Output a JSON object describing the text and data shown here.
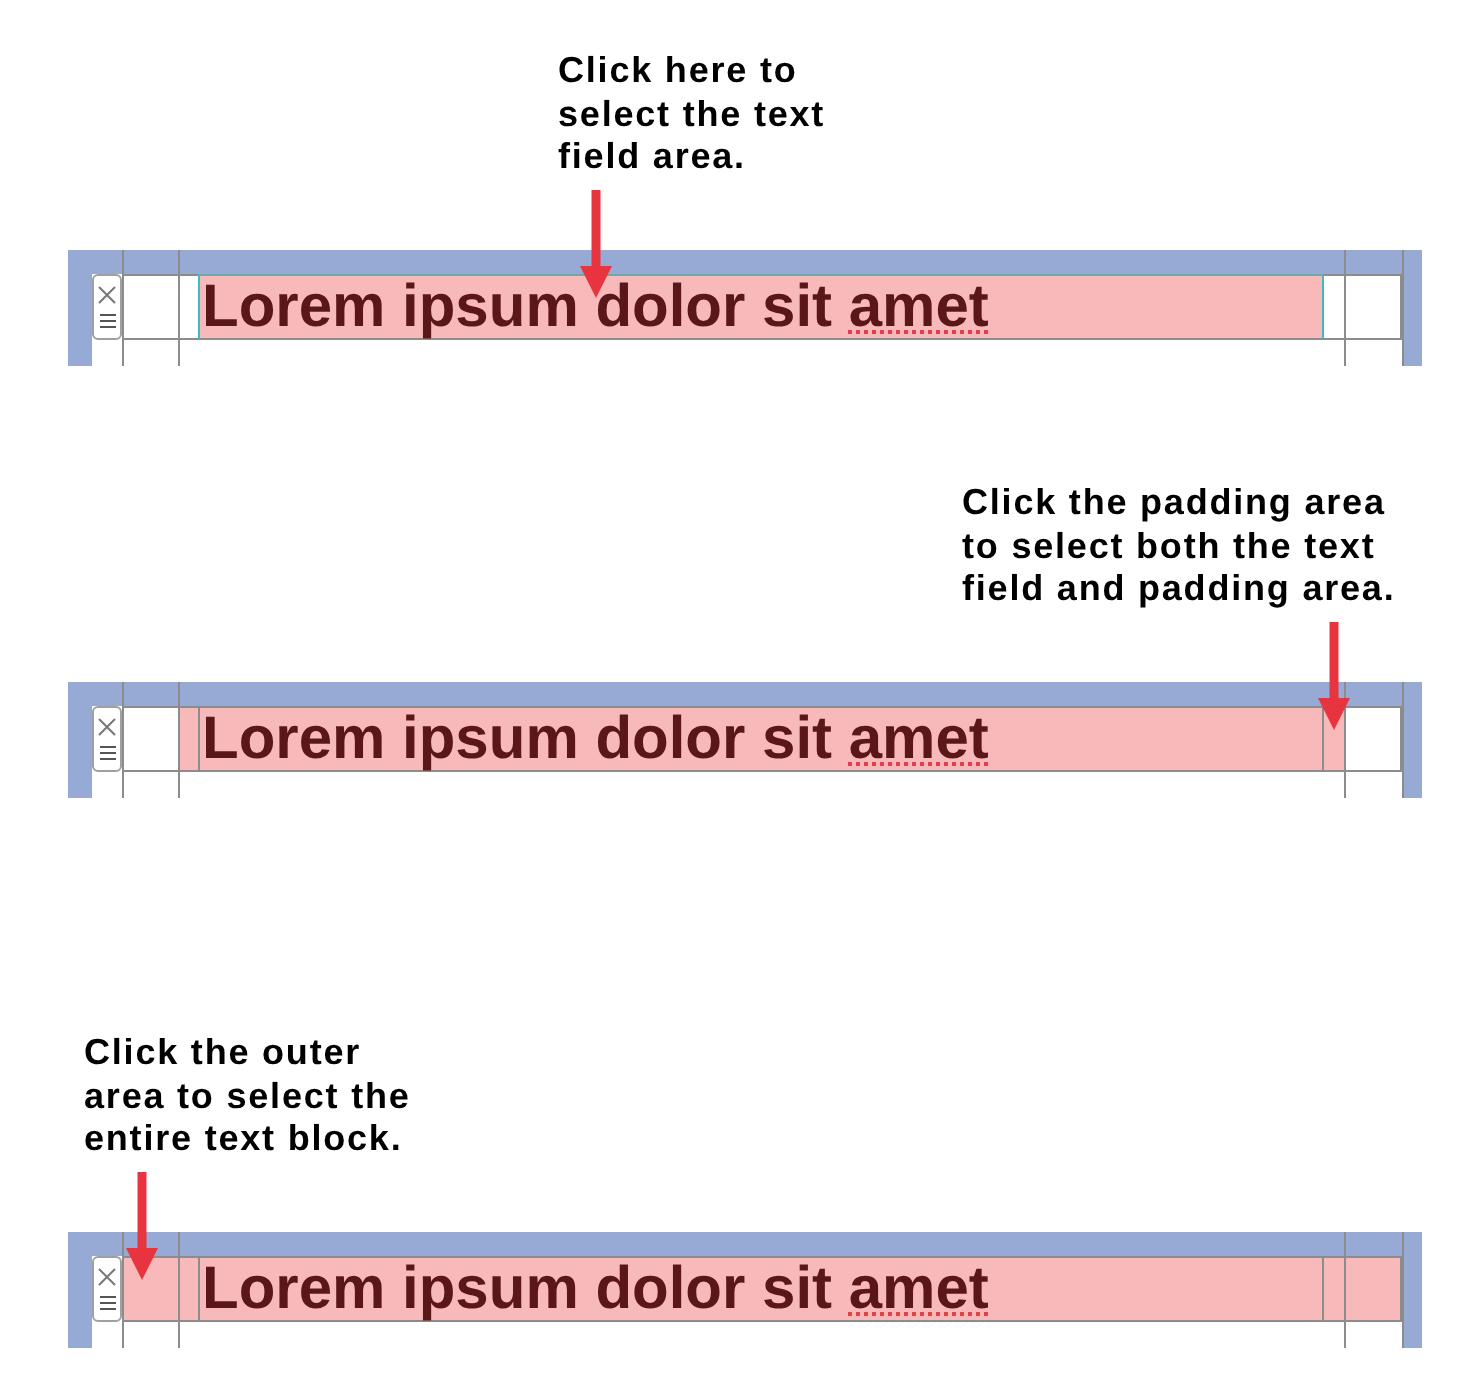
{
  "panels": [
    {
      "callout": "Click here to\nselect the text\nfield area.",
      "regions": [
        {
          "kind": "outer",
          "selected": false
        },
        {
          "kind": "padding",
          "selected": false
        },
        {
          "kind": "field",
          "selected": true
        }
      ],
      "field_text": [
        {
          "text": "Lorem ipsum dolor sit ",
          "misspelled": false
        },
        {
          "text": "amet",
          "misspelled": true
        }
      ]
    },
    {
      "callout": "Click the padding area\nto select both the text\nfield and padding area.",
      "regions": [
        {
          "kind": "outer",
          "selected": false
        },
        {
          "kind": "padding",
          "selected": true
        },
        {
          "kind": "field",
          "selected": false
        }
      ],
      "field_text": [
        {
          "text": "Lorem ipsum dolor sit ",
          "misspelled": false
        },
        {
          "text": "amet",
          "misspelled": true
        }
      ]
    },
    {
      "callout": "Click the outer\narea to select the\nentire text block.",
      "regions": [
        {
          "kind": "outer",
          "selected": true
        },
        {
          "kind": "padding",
          "selected": false
        },
        {
          "kind": "field",
          "selected": false
        }
      ],
      "field_text": [
        {
          "text": "Lorem ipsum dolor sit ",
          "misspelled": false
        },
        {
          "text": "amet",
          "misspelled": true
        }
      ]
    }
  ]
}
